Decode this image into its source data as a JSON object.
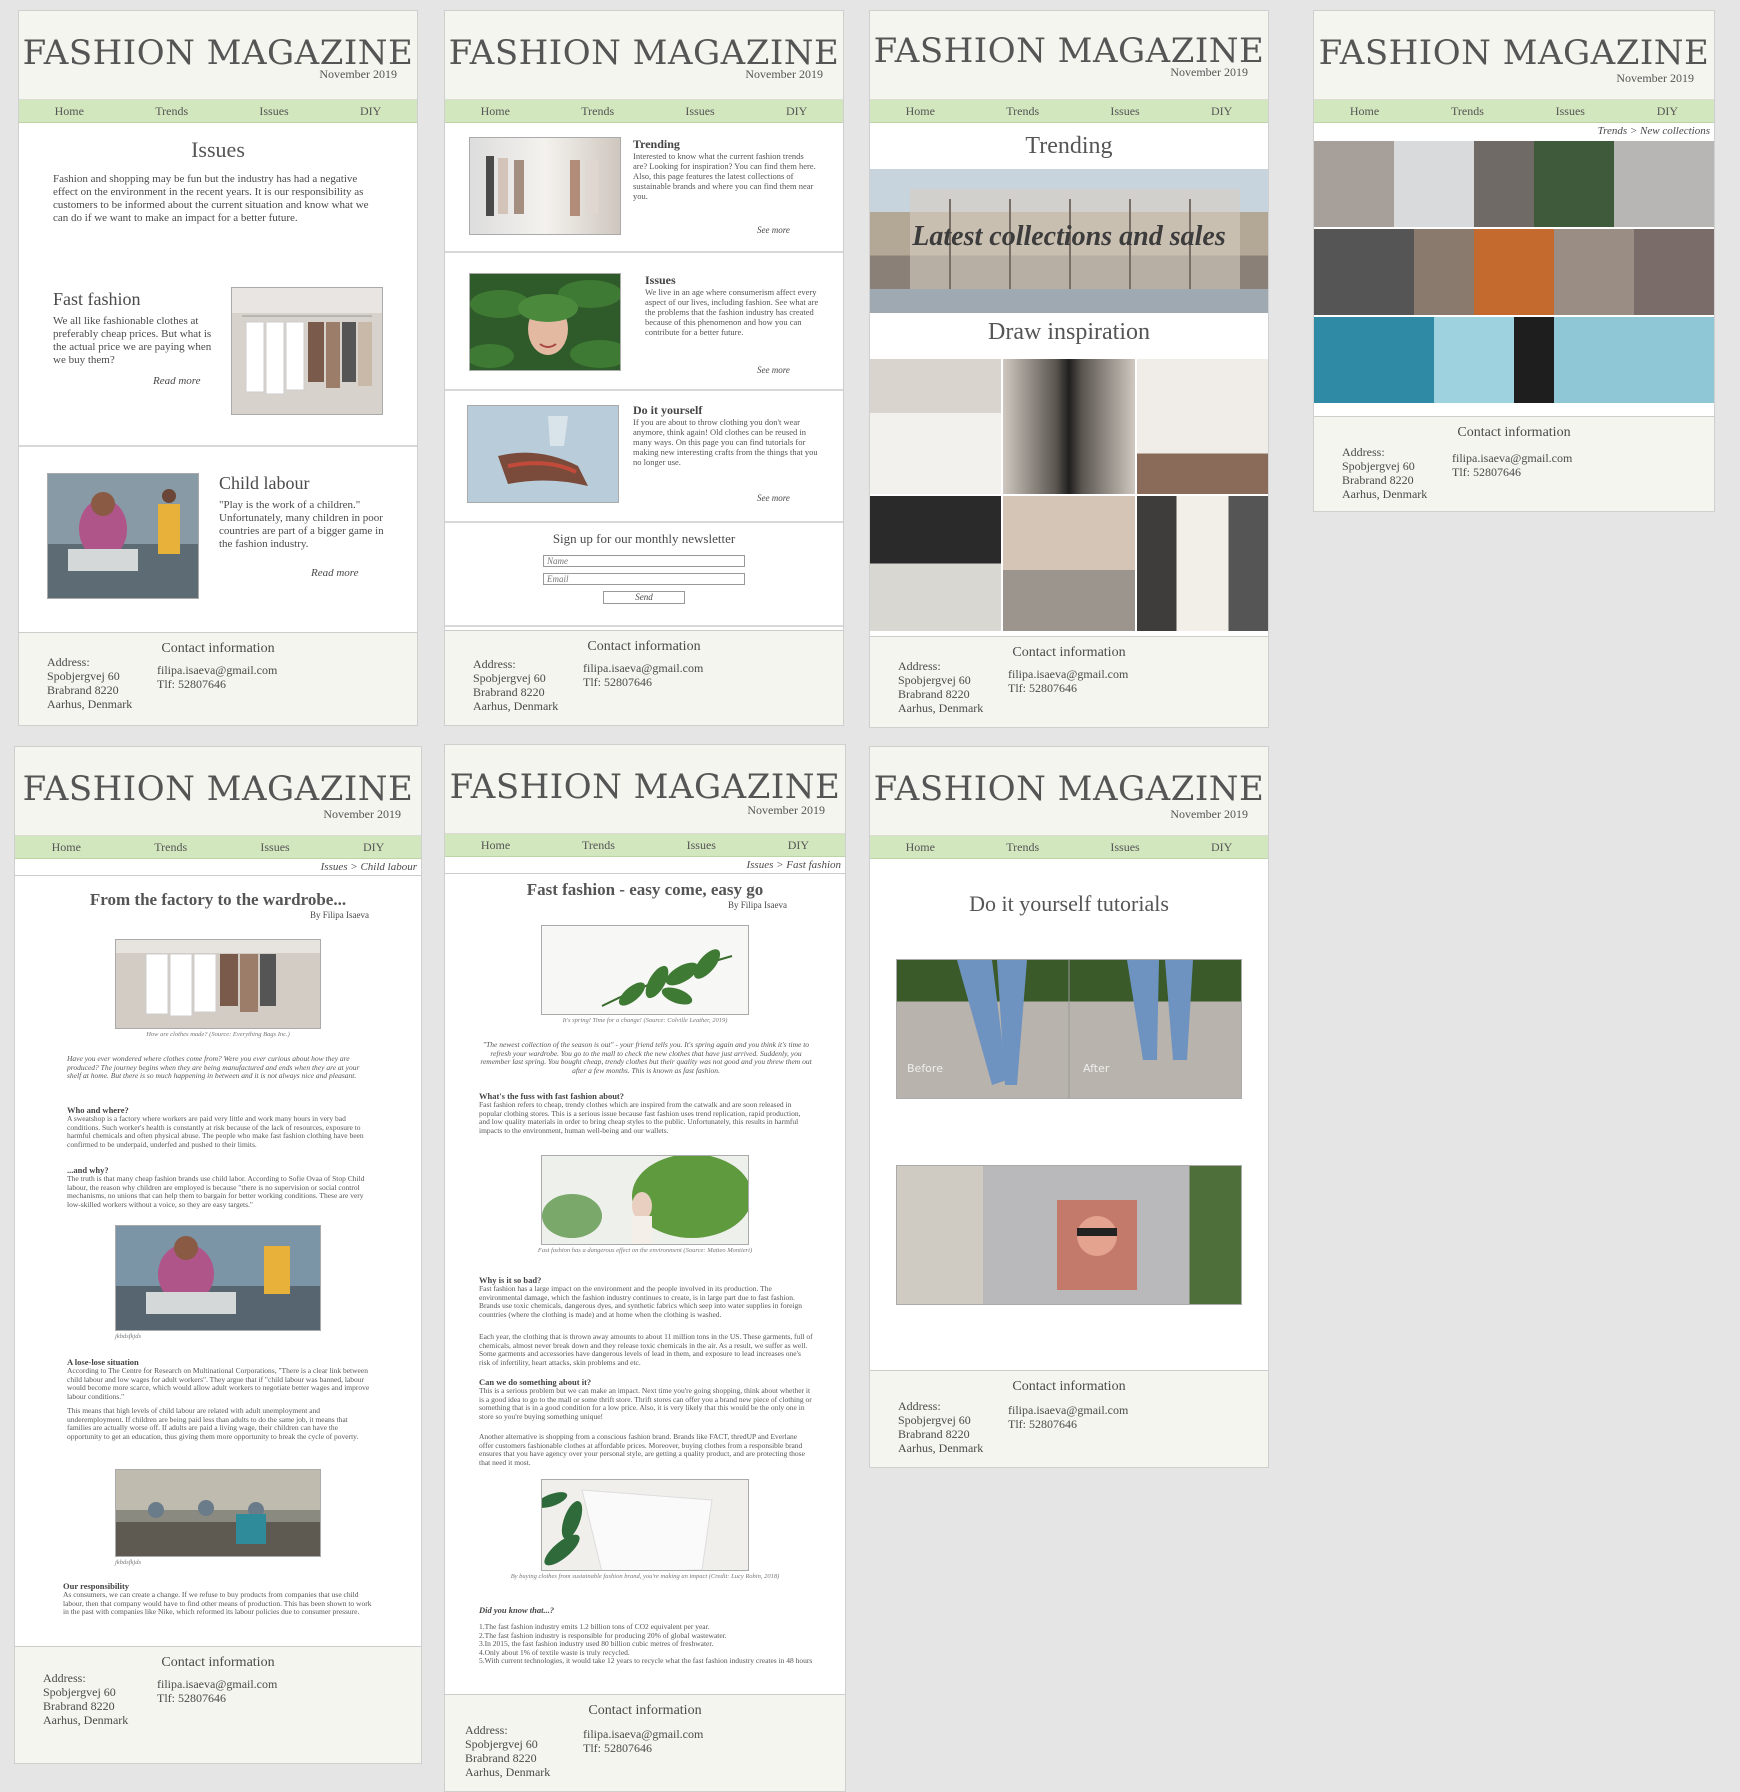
{
  "site": {
    "title": "FASHION MAGAZINE",
    "date": "November 2019",
    "nav": [
      "Home",
      "Trends",
      "Issues",
      "DIY"
    ],
    "contact": {
      "title": "Contact information",
      "address_lines": [
        "Address:",
        "Spobjergvej 60",
        "Brabrand 8220",
        "Aarhus, Denmark"
      ],
      "email": "filipa.isaeva@gmail.com",
      "phone": "Tlf: 52807646"
    }
  },
  "issues_page": {
    "heading": "Issues",
    "intro": "Fashion and shopping may be fun but the industry has had a negative effect on the environment in the recent years. It is our responsibility as customers to be informed about the current situation and know what we can do if we want to make an impact for a better future.",
    "fast_fashion": {
      "title": "Fast fashion",
      "text": "We all like fashionable clothes at preferably cheap prices. But what is the actual price we are paying when we buy them?",
      "more": "Read more"
    },
    "child_labour": {
      "title": "Child labour",
      "text": "\"Play is the work of a children.\" Unfortunately, many children in poor countries are part of a bigger game in the fashion industry.",
      "more": "Read more"
    }
  },
  "home_page": {
    "trending": {
      "title": "Trending",
      "text": "Interested to know what the current fashion trends are? Looking for inspiration? You can find them here. Also, this page features the latest collections of sustainable brands and where you can find them near you.",
      "more": "See more"
    },
    "issues": {
      "title": "Issues",
      "text": "We live in an age where consumerism affect every aspect of our lives, including fashion. See what are the problems that the fashion industry has created because of this phenomenon and how you can contribute for a better future.",
      "more": "See more"
    },
    "diy": {
      "title": "Do it yourself",
      "text": "If you are about to throw clothing you don't wear anymore, think again! Old clothes can be reused in many ways. On this page you can find tutorials for making new interesting crafts from the things that you no longer use.",
      "more": "See more"
    },
    "newsletter": {
      "title": "Sign up for our monthly newsletter",
      "name_placeholder": "Name",
      "email_placeholder": "Email",
      "send": "Send"
    }
  },
  "trending_page": {
    "heading": "Trending",
    "banner": "Latest collections and sales",
    "inspiration": "Draw inspiration"
  },
  "collections_page": {
    "breadcrumb": "Trends > New collections"
  },
  "child_labour_page": {
    "breadcrumb": "Issues > Child labour",
    "title": "From the factory to the wardrobe...",
    "byline": "By Filipa Isaeva",
    "caption1": "How are clothes made? (Source: Everything Bags Inc.)",
    "lead": "Have you ever wondered where clothes come from? Were you ever curious about how they are produced? The journey begins when they are being manufactured and ends when they are at your shelf at home. But there is so much happening in between and it is not always nice and pleasant.",
    "s1_title": "Who and where?",
    "s1_text": "A sweatshop is a factory where workers are paid very little and work many hours in very bad conditions. Such worker's health is constantly at risk because of the lack of resources, exposure to harmful chemicals and often physical abuse. The people who make fast fashion clothing have been confirmed to be underpaid, underfed and pushed to their limits.",
    "s2_title": "...and why?",
    "s2_text": "The truth is that many cheap fashion brands use child labor. According to Sofie Ovaa of Stop Child labour, the reason why children are employed is because \"there is no supervision or social control mechanisms, no unions that can help them to bargain for better working conditions. These are very low-skilled workers without a voice, so they are easy targets.\"",
    "caption2": "jkbdsfkjds",
    "s3_title": "A lose-lose situation",
    "s3_text": "According to The Centre for Research on Multinational Corporations, \"There is a clear link between child labour and low wages for adult workers\". They argue that if \"child labour was banned, labour would become more scarce, which would allow adult workers to negotiate better wages and improve labour conditions.\"",
    "s3_text2": "This means that high levels of child labour are related with adult unemployment and underemployment. If children are being paid less than adults to do the same job, it means that families are actually worse off. If adults are paid a living wage, their children can have the opportunity to get an education, thus giving them more opportunity to break the cycle of poverty.",
    "caption3": "jkbdsfkjds",
    "s4_title": "Our responsibility",
    "s4_text": "As consumers, we can create a change. If we refuse to buy products from companies that use child labour, then that company would have to find other means of production. This has been shown to work in the past with companies like Nike, which reformed its labour policies due to consumer pressure."
  },
  "fast_fashion_page": {
    "breadcrumb": "Issues > Fast fashion",
    "title": "Fast fashion - easy come, easy go",
    "byline": "By Filipa Isaeva",
    "caption1": "It's spring! Time for a change! (Source: Colville Leather, 2019)",
    "quote": "\"The newest collection of the season is out\" - your friend tells you. It's spring again and you think it's time to refresh your wardrobe. You go to the mall to check the new clothes that have just arrived. Suddenly, you remember last spring. You bought cheap, trendy clothes but their quality was not good and you threw them out after a few months. This is known as fast fashion.",
    "s1_title": "What's the fuss with fast fashion about?",
    "s1_text": "Fast fashion refers to cheap, trendy clothes which are inspired from the catwalk and are soon released in popular clothing stores. This is a serious issue because fast fashion uses trend replication, rapid production, and low quality materials in order to bring cheap styles to the public. Unfortunately, this results in harmful impacts to the environment, human well-being and our wallets.",
    "caption2": "Fast fashion has a dangerous effect on the environment (Source: Matteo Montieri)",
    "s2_title": "Why is it so bad?",
    "s2_text": "Fast fashion has a large impact on the environment and the people involved in its production. The environmental damage, which the fashion industry continues to create, is in large part due to fast fashion. Brands use toxic chemicals, dangerous dyes, and synthetic fabrics which seep into water supplies in foreign countries (where the clothing is made) and at home when the clothing is washed.",
    "s2_text2": "Each year, the clothing that is thrown away amounts to about 11 million tons in the US. These garments, full of chemicals, almost never break down and they release toxic chemicals in the air. As a result, we suffer as well. Some garments and accessories have dangerous levels of lead in them, and exposure to lead increases one's risk of infertility, heart attacks, skin problems and etc.",
    "s3_title": "Can we do something about it?",
    "s3_text": "This is a serious problem but we can make an impact. Next time you're going shopping, think about whether it is a good idea to go to the mall or some thrift store. Thrift stores can offer you a brand new piece of clothing or something that is in a good condition for a low price. Also, it is very likely that this would be the only one in store so you're buying something unique!",
    "s3_text2": "Another alternative is shopping from a conscious fashion brand. Brands like FACT, thredUP and Everlane offer customers fashionable clothes at affordable prices. Moreover, buying clothes from a responsible brand ensures that you have agency over your personal style, are getting a quality product, and are protecting those that need it most.",
    "caption3": "By buying clothes from sustainable fashion brand, you're making an impact (Credit: Lucy Robin, 2018)",
    "did_title": "Did you know that...?",
    "facts": [
      "1.The fast fashion industry emits 1.2 billion tons of CO2 equivalent per year.",
      "2.The fast fashion industry is responsible for producing 20% of global wastewater.",
      "3.In 2015, the fast fashion industry used 80 billion cubic metres of freshwater.",
      "4.Only about 1% of textile waste is truly recycled.",
      "5.With current technologies, it would take 12 years to recycle what the fast fashion industry creates in 48 hours"
    ]
  },
  "diy_page": {
    "heading": "Do it yourself tutorials",
    "before": "Before",
    "after": "After"
  },
  "colors": {
    "nav": "#d3e7bf",
    "header": "#f5f5ef",
    "canvas": "#e5e5e5"
  }
}
